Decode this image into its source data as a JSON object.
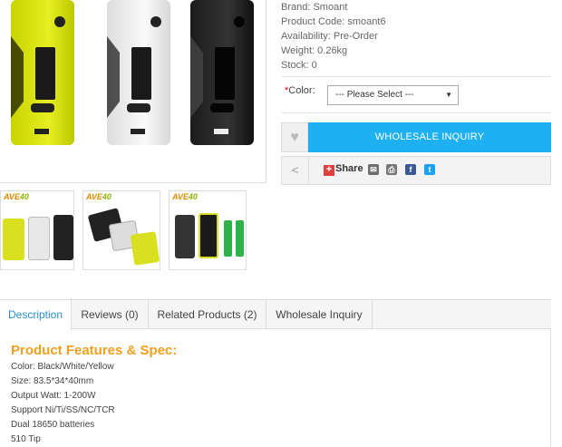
{
  "product": {
    "brand_label": "Brand: Smoant",
    "code_label": "Product Code: smoant6",
    "availability_label": "Availability: Pre-Order",
    "weight_label": "Weight: 0.26kg",
    "stock_label": "Stock: 0"
  },
  "thumbnails": [
    {
      "brand_a": "AVE",
      "brand_b": "40",
      "alt": "thumbnail-three-colors"
    },
    {
      "brand_a": "AVE",
      "brand_b": "40",
      "alt": "thumbnail-box-angles"
    },
    {
      "brand_a": "AVE",
      "brand_b": "40",
      "alt": "thumbnail-with-batteries"
    }
  ],
  "options": {
    "required_mark": "*",
    "color_label": "Color:",
    "select_value": "--- Please Select ---"
  },
  "actions": {
    "wholesale_button": "WHOLESALE INQUIRY",
    "share_label": "Share"
  },
  "tabs": [
    {
      "label": "Description"
    },
    {
      "label": "Reviews (0)"
    },
    {
      "label": "Related Products (2)"
    },
    {
      "label": "Wholesale Inquiry"
    }
  ],
  "description": {
    "title": "Product Features & Spec:",
    "specs": [
      "Color: Black/White/Yellow",
      "Size: 83.5*34*40mm",
      "Output Watt: 1-200W",
      "Support Ni/Ti/SS/NC/TCR",
      "Dual 18650 batteries",
      "510 Tip"
    ]
  },
  "colors": {
    "accent": "#1eb0f0",
    "feature_title": "#f0a020",
    "active_tab": "#2a8fd0"
  }
}
